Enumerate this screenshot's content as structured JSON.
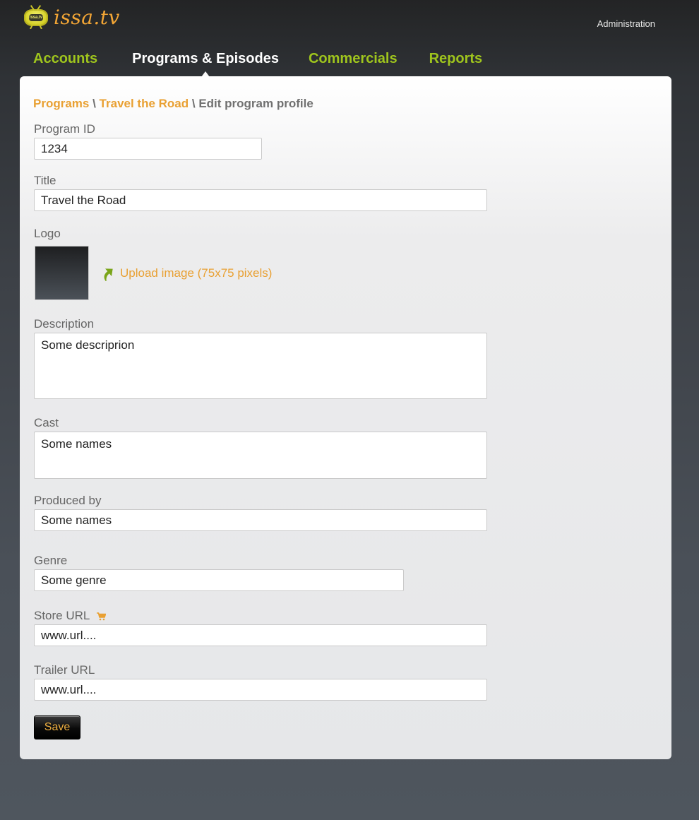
{
  "header": {
    "brand": "issa.tv",
    "brand_badge": "issa.tv",
    "admin_label": "Administration"
  },
  "nav": {
    "items": [
      {
        "label": "Accounts",
        "active": false
      },
      {
        "label": "Programs & Episodes",
        "active": true
      },
      {
        "label": "Commercials",
        "active": false
      },
      {
        "label": "Reports",
        "active": false
      }
    ]
  },
  "breadcrumb": {
    "root": "Programs",
    "sep1": " \\ ",
    "program": "Travel the Road",
    "sep2": " \\ ",
    "current": "Edit program profile"
  },
  "form": {
    "program_id": {
      "label": "Program ID",
      "value": "1234"
    },
    "title": {
      "label": "Title",
      "value": "Travel the Road"
    },
    "logo": {
      "label": "Logo",
      "upload_label": "Upload image (75x75 pixels)"
    },
    "description": {
      "label": "Description",
      "value": "Some descriprion"
    },
    "cast": {
      "label": "Cast",
      "value": "Some names"
    },
    "produced_by": {
      "label": "Produced by",
      "value": "Some names"
    },
    "genre": {
      "label": "Genre",
      "value": "Some genre"
    },
    "store_url": {
      "label": "Store URL",
      "value": "www.url...."
    },
    "trailer_url": {
      "label": "Trailer URL",
      "value": "www.url...."
    },
    "save_label": "Save"
  },
  "colors": {
    "accent_orange": "#e9a032",
    "nav_green": "#9fc51d",
    "upload_arrow_green": "#7aa51a"
  },
  "icons": [
    "tv-logo-icon",
    "upload-arrow-icon",
    "shopping-cart-icon"
  ]
}
